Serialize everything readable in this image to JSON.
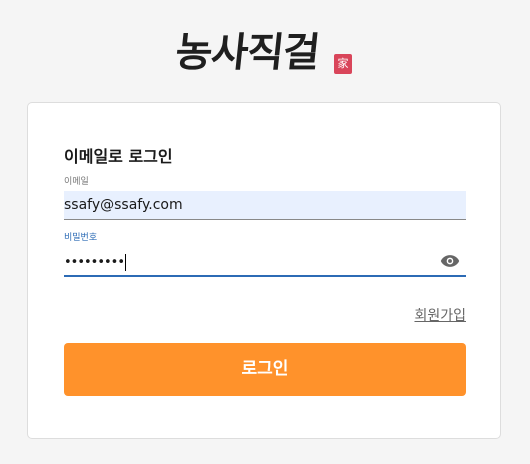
{
  "brand": {
    "logo_text": "농사직걸",
    "seal_text": "家"
  },
  "login": {
    "heading": "이메일로 로그인",
    "email": {
      "label": "이메일",
      "value": "ssafy@ssafy.com"
    },
    "password": {
      "label": "비밀번호",
      "value": "•••••••••",
      "toggle_icon": "eye-icon"
    },
    "signup_label": "회원가입",
    "submit_label": "로그인"
  },
  "colors": {
    "accent": "#ff922b",
    "focus": "#2c6bb5",
    "autofill": "#e8f0fe",
    "seal": "#d9455a"
  }
}
